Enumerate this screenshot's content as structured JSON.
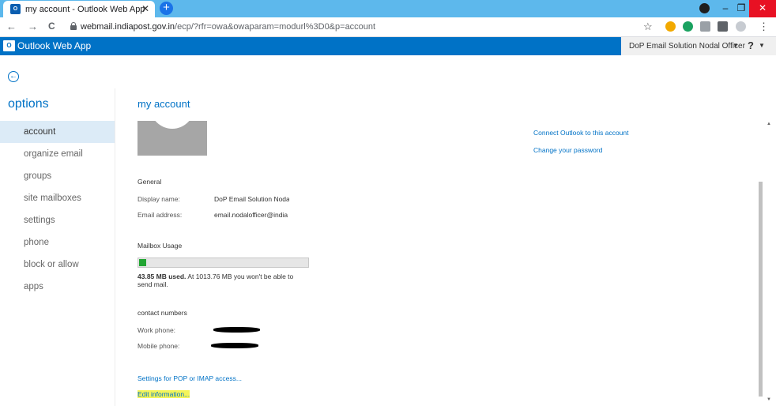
{
  "browser": {
    "tab_title": "my account - Outlook Web App",
    "tab_close": "✕",
    "new_tab": "+",
    "favicon_text": "O",
    "url_host": "webmail.indiapost.gov.in",
    "url_path": "/ecp/?rfr=owa&owaparam=modurl%3D0&p=account",
    "back": "←",
    "forward": "→",
    "reload": "C",
    "star": "☆",
    "minimize": "–",
    "maximize": "❐",
    "close": "✕",
    "menu": "⋮"
  },
  "owa": {
    "logo_text": "O",
    "app_title": "Outlook Web App",
    "user_name": "DoP Email Solution Nodal Officer",
    "user_caret": "▼",
    "help": "?",
    "help_caret": "▼"
  },
  "nav": {
    "back_icon": "←",
    "title": "options",
    "items": [
      {
        "label": "account",
        "active": true
      },
      {
        "label": "organize email"
      },
      {
        "label": "groups"
      },
      {
        "label": "site mailboxes"
      },
      {
        "label": "settings"
      },
      {
        "label": "phone"
      },
      {
        "label": "block or allow"
      },
      {
        "label": "apps"
      }
    ]
  },
  "account": {
    "title": "my account",
    "connect_link": "Connect Outlook to this account",
    "change_password_link": "Change your password",
    "general_heading": "General",
    "display_name_label": "Display name:",
    "display_name_value": "DoP Email Solution Noda",
    "email_label": "Email address:",
    "email_value": "email.nodalofficer@india",
    "usage_heading": "Mailbox Usage",
    "usage_fraction": 0.043,
    "usage_used": "43.85 MB used.",
    "usage_rest": " At 1013.76 MB you won't be able to send mail.",
    "contact_heading": "contact numbers",
    "work_phone_label": "Work phone:",
    "mobile_phone_label": "Mobile phone:",
    "pop_imap_link": "Settings for POP or IMAP access...",
    "edit_link": "Edit information..."
  },
  "colors": {
    "accent": "#0072c6",
    "usage_fill": "#22a533",
    "highlight": "#f4f55a"
  }
}
